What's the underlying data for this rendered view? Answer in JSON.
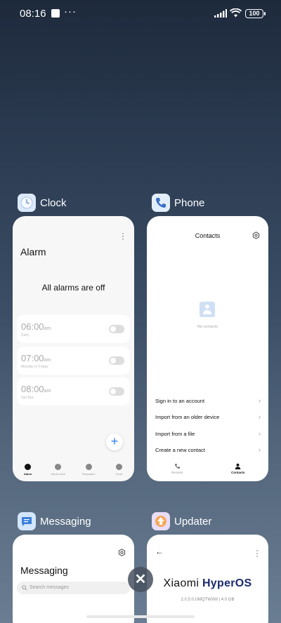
{
  "status_bar": {
    "time": "08:16",
    "more": "···",
    "battery": "100"
  },
  "apps": {
    "clock": {
      "name": "Clock",
      "card": {
        "title": "Alarm",
        "empty_text": "All alarms are off",
        "alarms": [
          {
            "time": "06:00",
            "ampm": "am",
            "repeat": "Daily"
          },
          {
            "time": "07:00",
            "ampm": "am",
            "repeat": "Monday to Friday"
          },
          {
            "time": "08:00",
            "ampm": "am",
            "repeat": "Get Bus"
          }
        ],
        "fab": "+",
        "nav": [
          "Alarm",
          "World clock",
          "Stopwatch",
          "Timer"
        ]
      }
    },
    "phone": {
      "name": "Phone",
      "card": {
        "title": "Contacts",
        "empty_text": "No contacts",
        "actions": [
          "Sign in to an account",
          "Import from an older device",
          "Import from a file",
          "Create a new contact"
        ],
        "nav": [
          "Recents",
          "Contacts"
        ]
      }
    },
    "messaging": {
      "name": "Messaging",
      "card": {
        "title": "Messaging",
        "search_placeholder": "Search messages"
      }
    },
    "updater": {
      "name": "Updater",
      "card": {
        "brand_prefix": "Xiaomi ",
        "brand_name": "HyperOS",
        "version": "2.0.5.0.UMQTWXM | 4.0 GB"
      }
    }
  },
  "close_button": "✕",
  "colors": {
    "accent_blue": "#2f7ff0",
    "brand_navy": "#1a2a6e"
  }
}
